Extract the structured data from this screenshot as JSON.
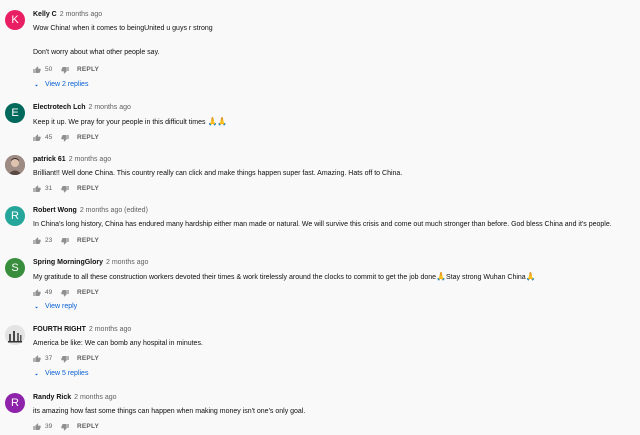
{
  "colors": {
    "reply_link": "#065fd4",
    "meta": "#606060",
    "text": "#0f0f0f"
  },
  "comments": [
    {
      "author": "Kelly C",
      "time": "2 months ago",
      "avatar_letter": "K",
      "avatar_color": "#e91e63",
      "lines": [
        "Wow China! when it comes to beingUnited u guys r strong",
        "Don't worry about what other people say."
      ],
      "likes": "50",
      "reply_label": "REPLY",
      "view_replies": "View 2 replies"
    },
    {
      "author": "Electrotech Lch",
      "time": "2 months ago",
      "avatar_letter": "E",
      "avatar_color": "#00695c",
      "lines": [
        "Keep it up. We pray for your people in this difficult times"
      ],
      "emoji": "🙏🙏",
      "likes": "45",
      "reply_label": "REPLY"
    },
    {
      "author": "patrick 61",
      "time": "2 months ago",
      "avatar_icon": "profile-photo-icon",
      "lines": [
        "Brilliant!!  Well done China.  This country really can click and make things happen super fast.  Amazing.  Hats off to China."
      ],
      "likes": "31",
      "reply_label": "REPLY"
    },
    {
      "author": "Robert Wong",
      "time": "2 months ago (edited)",
      "avatar_letter": "R",
      "avatar_color": "#26a69a",
      "lines": [
        "In China's long history, China  has endured many  hardship either man made or natural. We will survive this crisis and come out much stronger than before. God bless China and it's people."
      ],
      "likes": "23",
      "reply_label": "REPLY"
    },
    {
      "author": "Spring MorningGlory",
      "time": "2 months ago",
      "avatar_letter": "S",
      "avatar_color": "#388e3c",
      "lines": [
        "My gratitude to all these construction workers devoted their times & work tirelessly around the clocks to commit to get the job done"
      ],
      "line_middle": "Stay strong Wuhan China",
      "likes": "49",
      "reply_label": "REPLY",
      "view_replies": "View reply"
    },
    {
      "author": "FOURTH RIGHT",
      "time": "2 months ago",
      "avatar_icon": "profile-photo-icon",
      "lines": [
        "America be like: We can bomb any hospital in minutes."
      ],
      "likes": "37",
      "reply_label": "REPLY",
      "view_replies": "View 5 replies"
    },
    {
      "author": "Randy Rick",
      "time": "2 months ago",
      "avatar_letter": "R",
      "avatar_color": "#8e24aa",
      "lines": [
        "its amazing how fast some things can happen when making money isn't one's only goal."
      ],
      "likes": "39",
      "reply_label": "REPLY"
    }
  ]
}
